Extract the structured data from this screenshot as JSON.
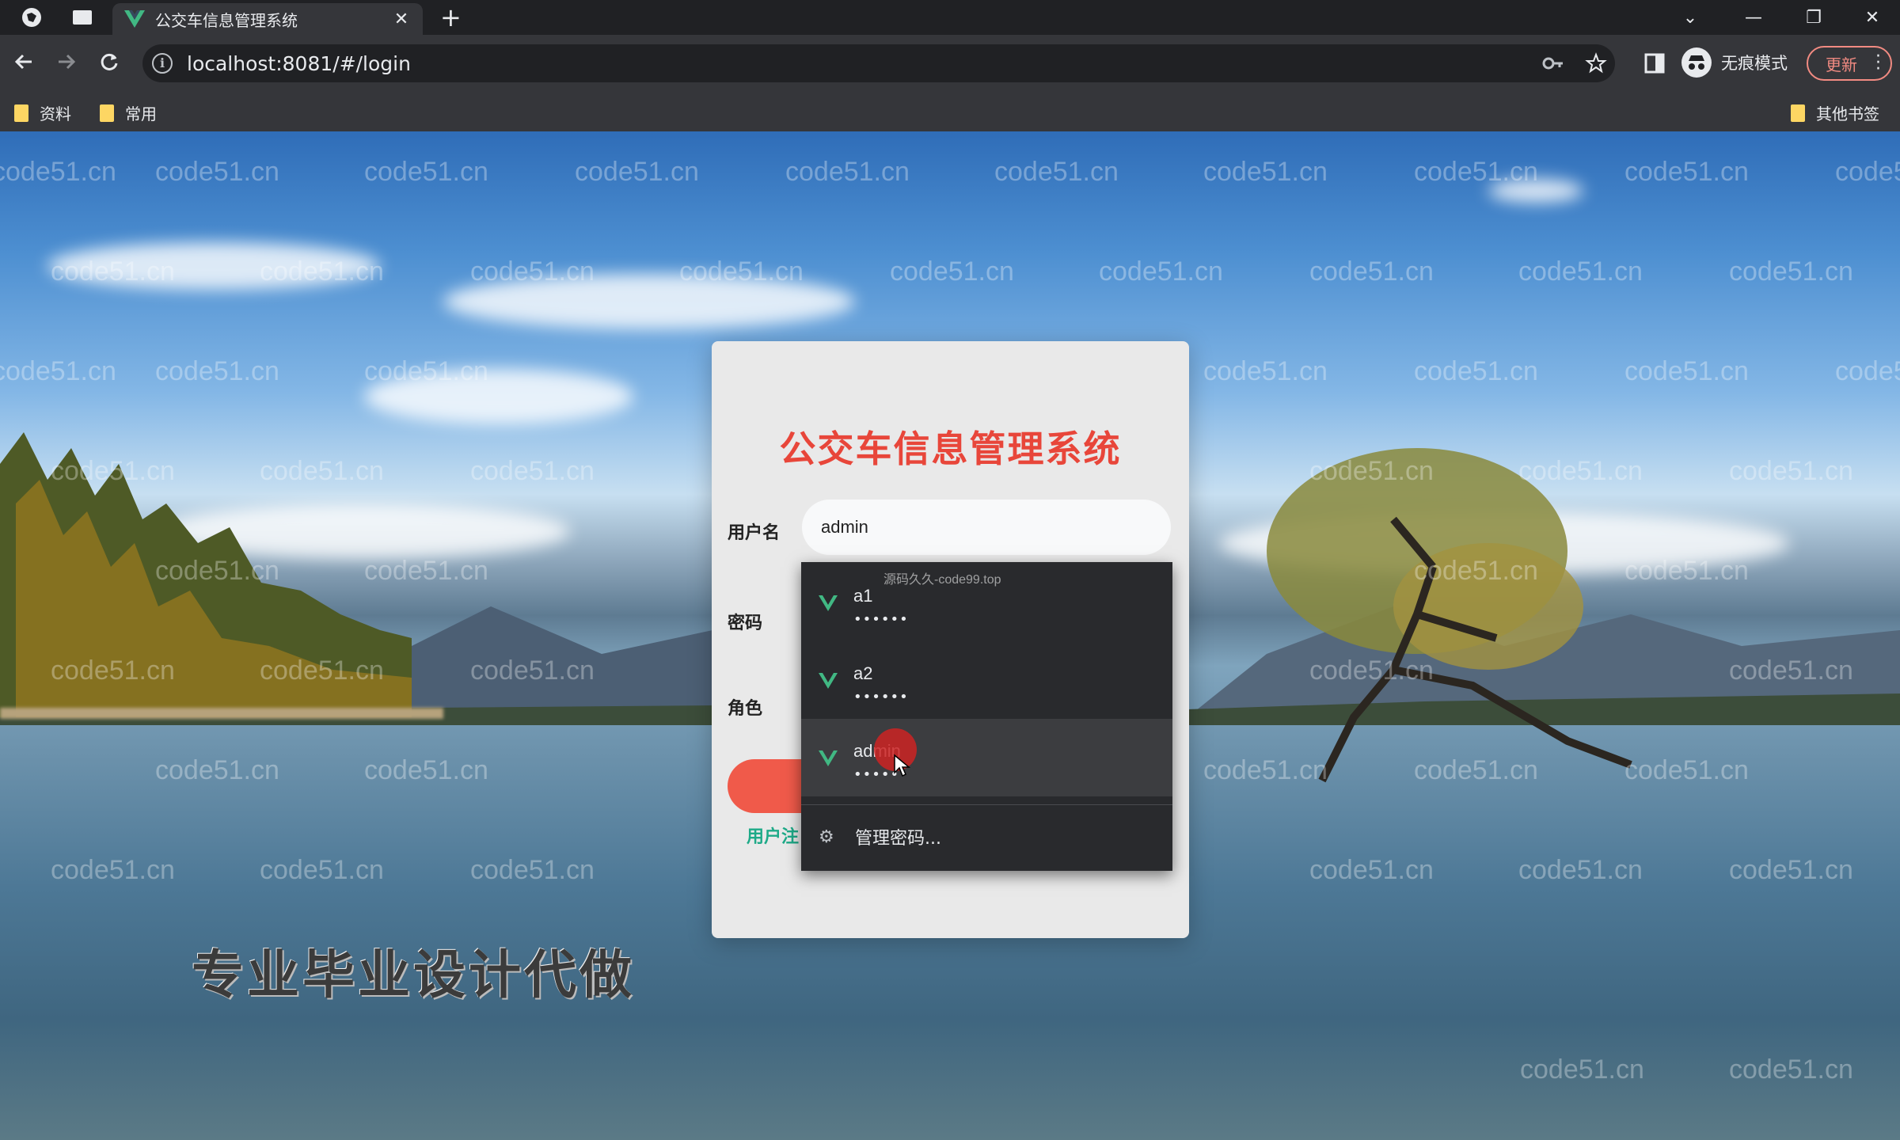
{
  "browser": {
    "tab_title": "公交车信息管理系统",
    "url": "localhost:8081/#/login",
    "incognito_label": "无痕模式",
    "update_label": "更新",
    "bookmarks": [
      "资料",
      "常用"
    ],
    "other_bookmarks": "其他书签"
  },
  "watermark": "code51.cn",
  "login": {
    "title": "公交车信息管理系统",
    "username_label": "用户名",
    "username_value": "admin",
    "password_label": "密码",
    "role_label": "角色",
    "register_link": "用户注"
  },
  "autofill": {
    "note": "源码久久-code99.top",
    "items": [
      {
        "user": "a1",
        "password_mask": "••••••"
      },
      {
        "user": "a2",
        "password_mask": "••••••"
      },
      {
        "user": "admin",
        "password_mask": "•••••"
      }
    ],
    "manage_label": "管理密码..."
  },
  "overlay_text": "专业毕业设计代做",
  "colors": {
    "title_red": "#e8463a",
    "vue_green": "#41b883",
    "register_green": "#1eaa88"
  }
}
